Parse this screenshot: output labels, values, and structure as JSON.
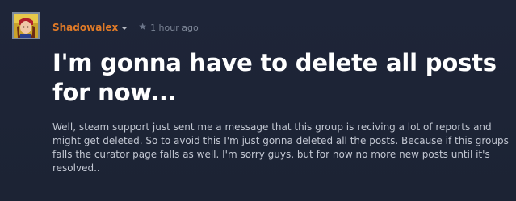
{
  "post": {
    "author": "Shadowalex",
    "timestamp": "1 hour ago",
    "star_icon": "star-icon",
    "caret_icon": "chevron-down-icon",
    "title": "I'm gonna have to delete all posts for now...",
    "body": "Well, steam support just sent me a message that this group is reciving a lot of reports and might get deleted. So to avoid this I'm just gonna deleted all the posts. Because if this groups falls the curator page falls as well. I'm sorry guys, but for now no more new posts until it's resolved..",
    "colors": {
      "background": "#1d2433",
      "author": "#e07a27",
      "title": "#ffffff",
      "body": "#c2c7d2",
      "meta": "#7c8596"
    }
  }
}
